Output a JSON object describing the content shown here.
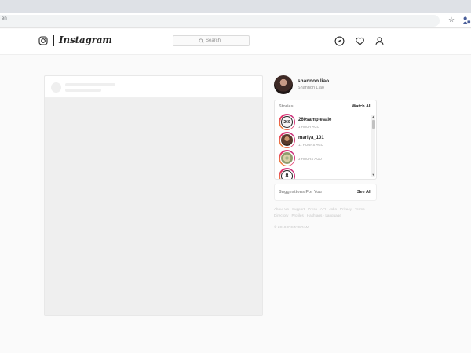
{
  "browser": {
    "url_fragment": "en",
    "bookmark_icon": "star-icon",
    "extension_icon": "extension-icon"
  },
  "nav": {
    "logo_icon": "instagram-camera-icon",
    "wordmark": "Instagram",
    "search_placeholder": "Search",
    "icons": [
      "compass-icon",
      "heart-icon",
      "user-icon"
    ]
  },
  "sidebar": {
    "username": "shannon.liao",
    "full_name": "Shannon Liao",
    "stories": {
      "title": "Stories",
      "watch_all": "Watch All",
      "items": [
        {
          "name": "260samplesale",
          "avatar_text": "260",
          "time": "1 HOUR AGO"
        },
        {
          "name": "mariya_101",
          "avatar_text": "",
          "time": "11 HOURS AGO"
        },
        {
          "name": "",
          "avatar_text": "",
          "time": "3 HOURS AGO"
        },
        {
          "name": "",
          "avatar_text": "8",
          "time": ""
        }
      ]
    },
    "suggestions": {
      "title": "Suggestions For You",
      "see_all": "See All"
    },
    "footer_links": "About Us · Support · Press · API · Jobs · Privacy · Terms · Directory · Profiles · Hashtags · Language",
    "copyright": "© 2018 INSTAGRAM"
  },
  "colors": {
    "background": "#fafafa",
    "text_primary": "#262626",
    "text_secondary": "#8e8e8e",
    "story_ring_start": "#f5a623",
    "story_ring_end": "#c13584"
  }
}
